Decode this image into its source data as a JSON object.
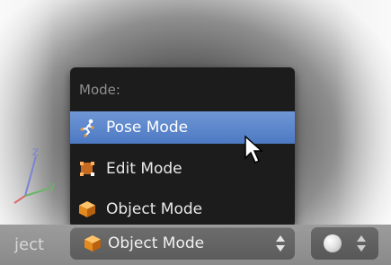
{
  "menu": {
    "title": "Mode:",
    "items": [
      {
        "label": "Pose Mode",
        "icon": "pose-icon",
        "highlighted": true
      },
      {
        "label": "Edit Mode",
        "icon": "edit-icon",
        "highlighted": false
      },
      {
        "label": "Object Mode",
        "icon": "object-cube-icon",
        "highlighted": false
      }
    ]
  },
  "viewport": {
    "axes": {
      "z": "z",
      "y": "y"
    }
  },
  "header": {
    "left_text": "ject",
    "mode_select_value": "Object Mode",
    "mode_select_icon": "object-cube-icon",
    "shading_icon": "sphere-icon"
  },
  "colors": {
    "highlight": "#5a84c8",
    "menu_bg": "#1c1c1c",
    "cube_orange": "#e58a1f"
  }
}
